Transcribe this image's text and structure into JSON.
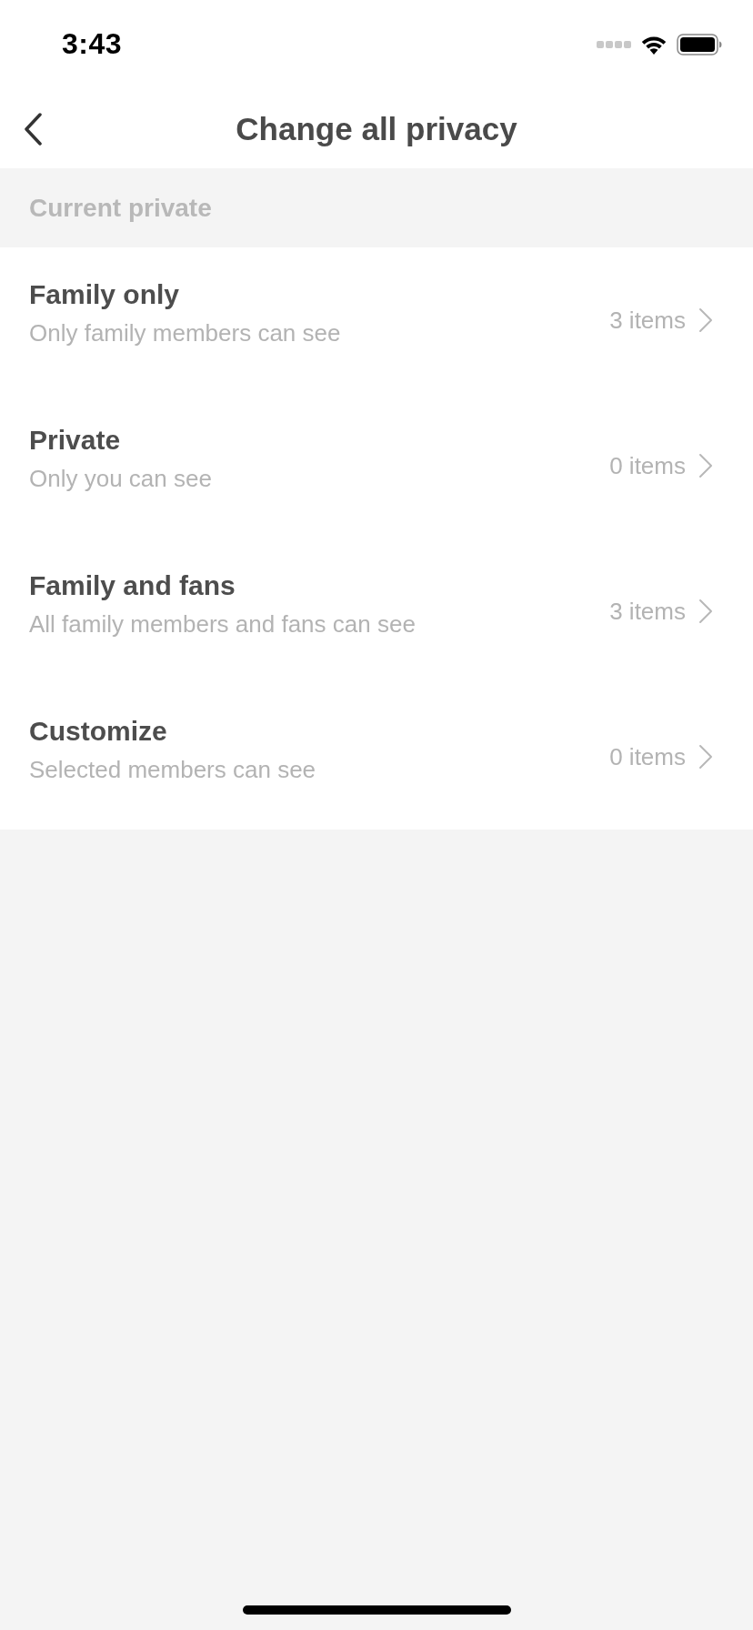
{
  "status_bar": {
    "time": "3:43"
  },
  "header": {
    "title": "Change all privacy"
  },
  "section": {
    "title": "Current private"
  },
  "options": [
    {
      "title": "Family only",
      "description": "Only family members can see",
      "count": "3 items"
    },
    {
      "title": "Private",
      "description": "Only you can see",
      "count": "0 items"
    },
    {
      "title": "Family and fans",
      "description": "All family members and fans can see",
      "count": "3 items"
    },
    {
      "title": "Customize",
      "description": "Selected members can see",
      "count": "0 items"
    }
  ]
}
